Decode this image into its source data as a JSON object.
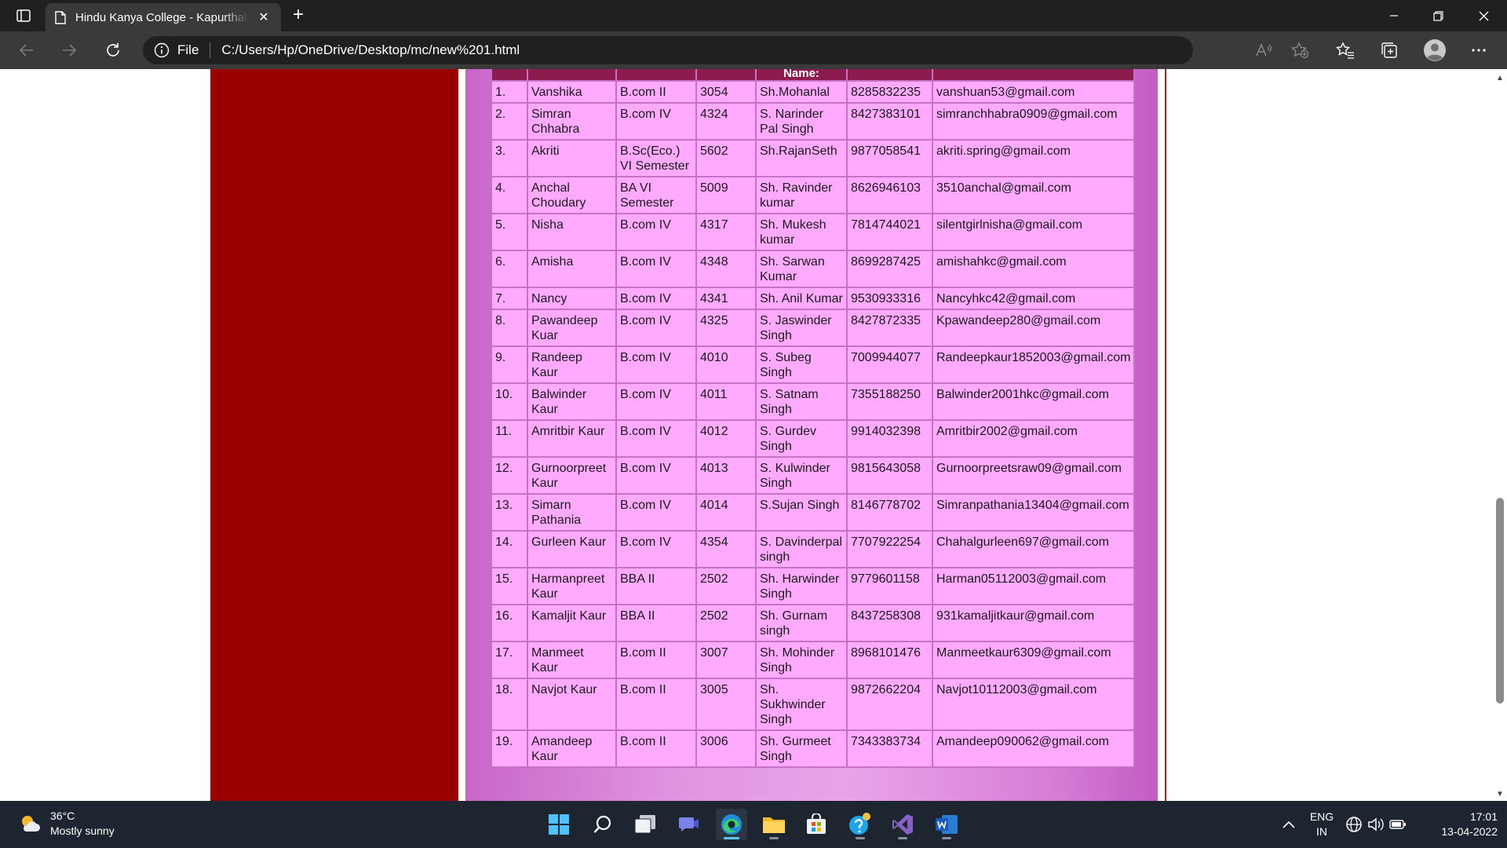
{
  "browser": {
    "tab_title": "Hindu Kanya College - Kapurthala",
    "new_tab_symbol": "+",
    "close_tab_symbol": "✕",
    "file_label": "File",
    "url": "C:/Users/Hp/OneDrive/Desktop/mc/new%201.html"
  },
  "table": {
    "header_visible_text": "Name:",
    "rows": [
      {
        "no": "1.",
        "name": "Vanshika",
        "class": "B.com II",
        "roll": "3054",
        "father": "Sh.Mohanlal",
        "phone": "8285832235",
        "email": "vanshuan53@gmail.com"
      },
      {
        "no": "2.",
        "name": "Simran Chhabra",
        "class": "B.com IV",
        "roll": "4324",
        "father": "S. Narinder Pal Singh",
        "phone": "8427383101",
        "email": "simranchhabra0909@gmail.com"
      },
      {
        "no": "3.",
        "name": "Akriti",
        "class": "B.Sc(Eco.) VI Semester",
        "roll": "5602",
        "father": "Sh.RajanSeth",
        "phone": "9877058541",
        "email": "akriti.spring@gmail.com"
      },
      {
        "no": "4.",
        "name": "Anchal Choudary",
        "class": "BA VI Semester",
        "roll": "5009",
        "father": "Sh. Ravinder kumar",
        "phone": "8626946103",
        "email": "3510anchal@gmail.com"
      },
      {
        "no": "5.",
        "name": "Nisha",
        "class": "B.com IV",
        "roll": "4317",
        "father": "Sh. Mukesh kumar",
        "phone": "7814744021",
        "email": "silentgirlnisha@gmail.com"
      },
      {
        "no": "6.",
        "name": "Amisha",
        "class": "B.com IV",
        "roll": "4348",
        "father": "Sh. Sarwan Kumar",
        "phone": "8699287425",
        "email": "amishahkc@gmail.com"
      },
      {
        "no": "7.",
        "name": "Nancy",
        "class": "B.com IV",
        "roll": "4341",
        "father": "Sh. Anil Kumar",
        "phone": "9530933316",
        "email": "Nancyhkc42@gmail.com"
      },
      {
        "no": "8.",
        "name": "Pawandeep Kuar",
        "class": "B.com IV",
        "roll": "4325",
        "father": "S. Jaswinder Singh",
        "phone": "8427872335",
        "email": "Kpawandeep280@gmail.com"
      },
      {
        "no": "9.",
        "name": "Randeep Kaur",
        "class": "B.com IV",
        "roll": "4010",
        "father": "S. Subeg Singh",
        "phone": "7009944077",
        "email": "Randeepkaur1852003@gmail.com"
      },
      {
        "no": "10.",
        "name": "Balwinder Kaur",
        "class": "B.com IV",
        "roll": "4011",
        "father": "S. Satnam Singh",
        "phone": "7355188250",
        "email": "Balwinder2001hkc@gmail.com"
      },
      {
        "no": "11.",
        "name": "Amritbir Kaur",
        "class": "B.com IV",
        "roll": "4012",
        "father": "S. Gurdev Singh",
        "phone": "9914032398",
        "email": "Amritbir2002@gmail.com"
      },
      {
        "no": "12.",
        "name": "Gurnoorpreet Kaur",
        "class": "B.com IV",
        "roll": "4013",
        "father": "S. Kulwinder Singh",
        "phone": "9815643058",
        "email": "Gurnoorpreetsraw09@gmail.com"
      },
      {
        "no": "13.",
        "name": "Simarn Pathania",
        "class": "B.com IV",
        "roll": "4014",
        "father": "S.Sujan Singh",
        "phone": "8146778702",
        "email": "Simranpathania13404@gmail.com"
      },
      {
        "no": "14.",
        "name": "Gurleen Kaur",
        "class": "B.com IV",
        "roll": "4354",
        "father": "S. Davinderpal singh",
        "phone": "7707922254",
        "email": "Chahalgurleen697@gmail.com"
      },
      {
        "no": "15.",
        "name": "Harmanpreet Kaur",
        "class": "BBA II",
        "roll": "2502",
        "father": "Sh. Harwinder Singh",
        "phone": "9779601158",
        "email": "Harman05112003@gmail.com"
      },
      {
        "no": "16.",
        "name": "Kamaljit Kaur",
        "class": "BBA II",
        "roll": "2502",
        "father": "Sh. Gurnam singh",
        "phone": "8437258308",
        "email": "931kamaljitkaur@gmail.com"
      },
      {
        "no": "17.",
        "name": "Manmeet Kaur",
        "class": "B.com II",
        "roll": "3007",
        "father": "Sh. Mohinder Singh",
        "phone": "8968101476",
        "email": "Manmeetkaur6309@gmail.com"
      },
      {
        "no": "18.",
        "name": "Navjot Kaur",
        "class": "B.com II",
        "roll": "3005",
        "father": "Sh. Sukhwinder Singh",
        "phone": "9872662204",
        "email": "Navjot10112003@gmail.com"
      },
      {
        "no": "19.",
        "name": "Amandeep Kaur",
        "class": "B.com II",
        "roll": "3006",
        "father": "Sh. Gurmeet Singh",
        "phone": "7343383734",
        "email": "Amandeep090062@gmail.com"
      }
    ]
  },
  "taskbar": {
    "temperature": "36°C",
    "weather_desc": "Mostly sunny",
    "language_line1": "ENG",
    "language_line2": "IN",
    "time": "17:01",
    "date": "13-04-2022"
  },
  "colors": {
    "header_bg": "#8b1c4d",
    "cell_bg": "#ffaaff",
    "side_panel": "#990000",
    "edge_active": "#5cc8f5"
  },
  "icons": [
    "tab-actions-icon",
    "page-icon",
    "close-icon",
    "plus-icon",
    "minimize-icon",
    "restore-icon",
    "window-close-icon",
    "back-icon",
    "forward-icon",
    "refresh-icon",
    "info-icon",
    "read-aloud-icon",
    "add-favorite-icon",
    "favorites-icon",
    "collections-icon",
    "profile-icon",
    "more-icon",
    "weather-icon",
    "start-icon",
    "search-icon",
    "task-view-icon",
    "chat-icon",
    "edge-icon",
    "file-explorer-icon",
    "store-icon",
    "help-icon",
    "visual-studio-icon",
    "word-icon",
    "chevron-up-icon",
    "network-icon",
    "volume-icon",
    "battery-icon"
  ]
}
